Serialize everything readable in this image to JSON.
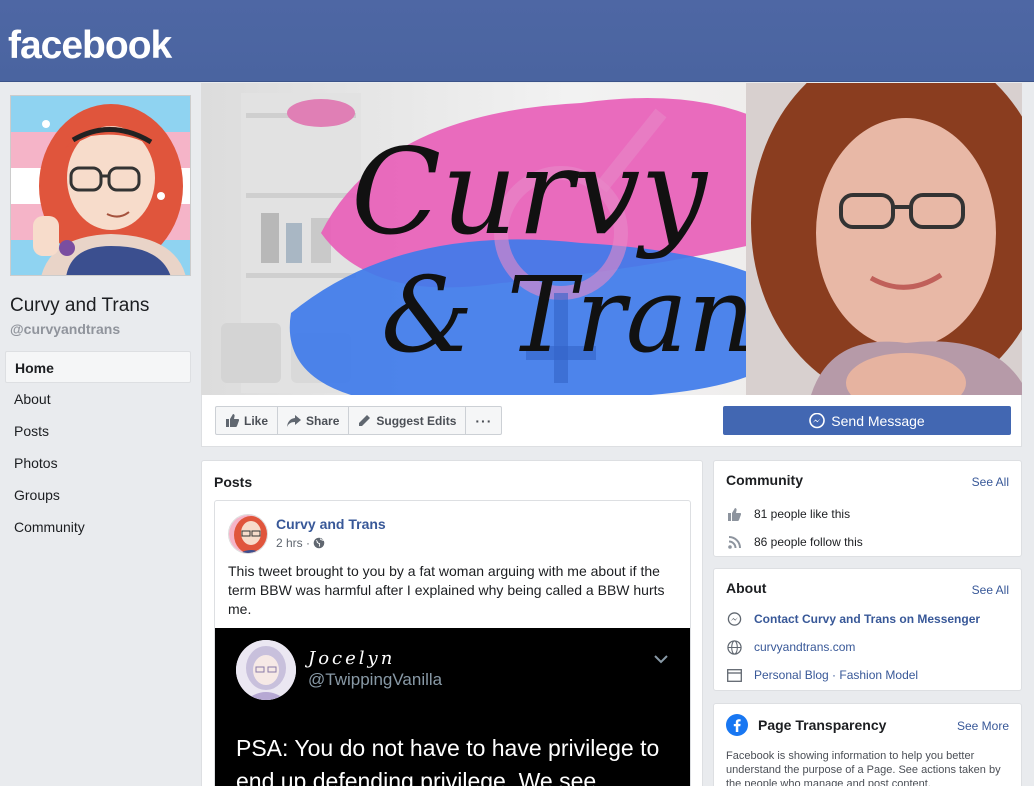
{
  "brand": {
    "logo_text": "facebook",
    "bar_color": "#4b65a1"
  },
  "page": {
    "name": "Curvy and Trans",
    "handle": "@curvyandtrans"
  },
  "nav": [
    {
      "label": "Home",
      "active": true
    },
    {
      "label": "About"
    },
    {
      "label": "Posts"
    },
    {
      "label": "Photos"
    },
    {
      "label": "Groups"
    },
    {
      "label": "Community"
    }
  ],
  "cover": {
    "title_line1": "Curvy",
    "title_line2": "& Trans"
  },
  "actions": {
    "like": "Like",
    "share": "Share",
    "suggest": "Suggest Edits",
    "more": "···",
    "send_message": "Send Message",
    "accent": "#4267b2"
  },
  "posts": {
    "title": "Posts",
    "items": [
      {
        "author": "Curvy and Trans",
        "time": "2 hrs ·",
        "text": "This tweet brought to you by a fat woman arguing with me about if the term BBW was harmful after I explained why being called a BBW hurts me.",
        "tweet": {
          "name": "Jocelyn",
          "handle": "@TwippingVanilla",
          "text": "PSA: You do not have to have privilege to end up defending privilege. We see"
        }
      }
    ]
  },
  "community": {
    "title": "Community",
    "see_all": "See All",
    "likes": "81 people like this",
    "follows": "86 people follow this"
  },
  "about": {
    "title": "About",
    "see_all": "See All",
    "messenger": "Contact Curvy and Trans on Messenger",
    "website": "curvyandtrans.com",
    "category": "Personal Blog · Fashion Model"
  },
  "transparency": {
    "title": "Page Transparency",
    "see_more": "See More",
    "text": "Facebook is showing information to help you better understand the purpose of a Page. See actions taken by the people who manage and post content."
  }
}
